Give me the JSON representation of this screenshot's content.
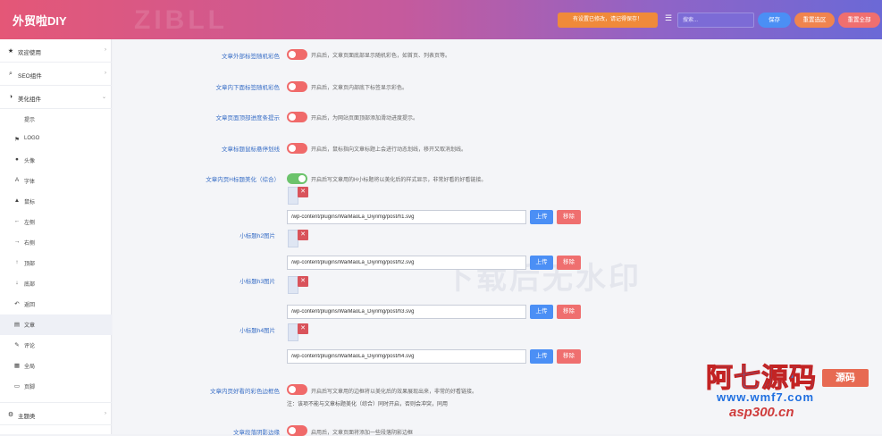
{
  "header": {
    "title": "外贸啦DIY",
    "watermark": "ZIBLL",
    "notice": "有设置已修改，请记得保存！",
    "search_placeholder": "搜索...",
    "save_label": "保存",
    "reset_area_label": "重置选区",
    "reset_all_label": "重置全部"
  },
  "sidebar": {
    "items": [
      {
        "label": "欢迎使用",
        "icon": "star-icon",
        "arrow": "›"
      },
      {
        "label": "SEO组件",
        "icon": "search-icon",
        "arrow": "›"
      },
      {
        "label": "美化组件",
        "icon": "half-circle-icon",
        "arrow": "⌄"
      }
    ],
    "sub_items": [
      {
        "label": "提示",
        "icon": ""
      },
      {
        "label": "LOGO",
        "icon": "flag-icon"
      },
      {
        "label": "头像",
        "icon": "user-icon"
      },
      {
        "label": "字体",
        "icon": "font-icon"
      },
      {
        "label": "鼠标",
        "icon": "cursor-icon"
      },
      {
        "label": "左侧",
        "icon": "arrow-left-icon"
      },
      {
        "label": "右侧",
        "icon": "arrow-right-icon"
      },
      {
        "label": "顶部",
        "icon": "arrow-up-icon"
      },
      {
        "label": "底部",
        "icon": "arrow-down-icon"
      },
      {
        "label": "返回",
        "icon": "undo-icon"
      },
      {
        "label": "文章",
        "icon": "document-icon"
      },
      {
        "label": "评论",
        "icon": "comment-icon"
      },
      {
        "label": "全局",
        "icon": "grid-icon"
      },
      {
        "label": "页脚",
        "icon": "footer-icon"
      }
    ],
    "bottom_item": {
      "label": "主题类",
      "icon": "gears-icon",
      "arrow": "›"
    }
  },
  "settings": {
    "row1": {
      "label": "文章外部标签随机彩色",
      "desc": "开启后，文章页面底部显示随机彩色，如首页、列表页等。"
    },
    "row2": {
      "label": "文章内下面标签随机彩色",
      "desc": "开启后，文章页内部底下标签显示彩色。"
    },
    "row3": {
      "label": "文章页面顶部进度条提示",
      "desc": "开启后，为网站页面顶部添加滑动进度提示。"
    },
    "row4": {
      "label": "文章标题鼠标悬停划线",
      "desc": "开启后，鼠标指向文章标题上会进行动态划线，移开又取消划线。"
    },
    "row5": {
      "label": "文章内页H标题美化（综合）",
      "desc": "开启后写文章用的H小标题将以美化后的样式显示，非常好看的好看链接。"
    },
    "h_images": [
      {
        "label": "",
        "path": "/wp-content/plugins/WaiMaoLa_Diy/img/post/h1.svg",
        "upload": "上传",
        "remove": "移除"
      },
      {
        "label": "小标题h2图片",
        "path": "/wp-content/plugins/WaiMaoLa_Diy/img/post/h2.svg",
        "upload": "上传",
        "remove": "移除"
      },
      {
        "label": "小标题h3图片",
        "path": "/wp-content/plugins/WaiMaoLa_Diy/img/post/h3.svg",
        "upload": "上传",
        "remove": "移除"
      },
      {
        "label": "小标题h4图片",
        "path": "/wp-content/plugins/WaiMaoLa_Diy/img/post/h4.svg",
        "upload": "上传",
        "remove": "移除"
      }
    ],
    "row6": {
      "label": "文章内页好看的彩色边框色",
      "desc": "开启后写文章用的边框将以美化后的效果展现出来，非常的好看链接。"
    },
    "row6_note": "注：该项不能与文章标题美化（综合）同时开启，否则会冲突，同用",
    "row7": {
      "label": "文章段落阴影边缘",
      "desc": "启用后，文章页面将添加一些段落阴影边框"
    },
    "center_watermark": "下载后无水印"
  },
  "logo": {
    "cn": "阿七源码",
    "tag": "源码",
    "url": "www.wmf7.com",
    "asp": "asp300.cn"
  },
  "colors": {
    "header_start": "#e45777",
    "header_end": "#6b69d6",
    "toggle_off": "#f06a6a",
    "toggle_on": "#6cc36c",
    "upload_btn": "#4b8ff5",
    "remove_btn": "#ef6f6f",
    "label_blue": "#3a6fc6"
  }
}
